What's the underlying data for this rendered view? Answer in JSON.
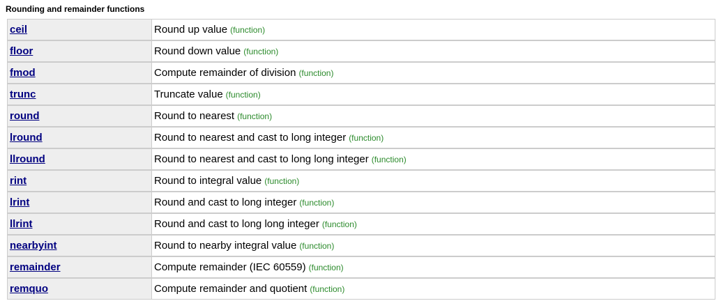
{
  "section": {
    "title": "Rounding and remainder functions"
  },
  "functions": [
    {
      "name": "ceil",
      "description": "Round up value",
      "kind": "(function)"
    },
    {
      "name": "floor",
      "description": "Round down value",
      "kind": "(function)"
    },
    {
      "name": "fmod",
      "description": "Compute remainder of division",
      "kind": "(function)"
    },
    {
      "name": "trunc",
      "description": "Truncate value",
      "kind": "(function)"
    },
    {
      "name": "round",
      "description": "Round to nearest",
      "kind": "(function)"
    },
    {
      "name": "lround",
      "description": "Round to nearest and cast to long integer",
      "kind": "(function)"
    },
    {
      "name": "llround",
      "description": "Round to nearest and cast to long long integer",
      "kind": "(function)"
    },
    {
      "name": "rint",
      "description": "Round to integral value",
      "kind": "(function)"
    },
    {
      "name": "lrint",
      "description": "Round and cast to long integer",
      "kind": "(function)"
    },
    {
      "name": "llrint",
      "description": "Round and cast to long long integer",
      "kind": "(function)"
    },
    {
      "name": "nearbyint",
      "description": "Round to nearby integral value",
      "kind": "(function)"
    },
    {
      "name": "remainder",
      "description": "Compute remainder (IEC 60559)",
      "kind": "(function)"
    },
    {
      "name": "remquo",
      "description": "Compute remainder and quotient",
      "kind": "(function)"
    }
  ],
  "colors": {
    "link": "#000080",
    "kind": "#2b8a2b",
    "name_cell_bg": "#eeeeee",
    "border": "#cccccc"
  }
}
